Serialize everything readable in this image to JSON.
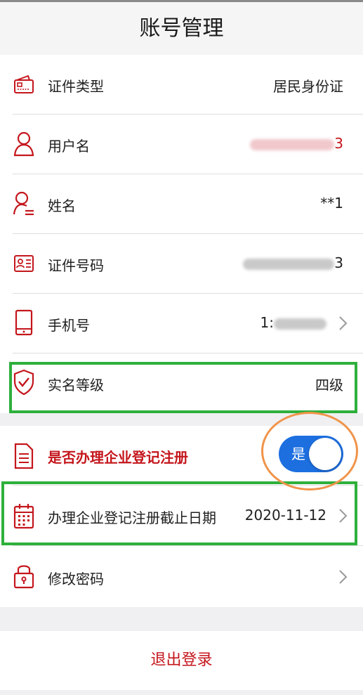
{
  "header": {
    "title": "账号管理"
  },
  "rows": {
    "id_type": {
      "label": "证件类型",
      "value": "居民身份证",
      "icon": "id-card-icon"
    },
    "username": {
      "label": "用户名",
      "value_tail": "3",
      "icon": "user-icon"
    },
    "name": {
      "label": "姓名",
      "value": "**1",
      "icon": "person-name-icon"
    },
    "id_number": {
      "label": "证件号码",
      "value_tail": "3",
      "icon": "id-badge-icon"
    },
    "phone": {
      "label": "手机号",
      "value_head": "1:",
      "icon": "mobile-phone-icon"
    },
    "realname_level": {
      "label": "实名等级",
      "value": "四级",
      "icon": "shield-check-icon"
    },
    "enterprise_registration": {
      "label": "是否办理企业登记注册",
      "toggle_label": "是",
      "toggle_on": true,
      "icon": "document-icon"
    },
    "registration_deadline": {
      "label": "办理企业登记注册截止日期",
      "value": "2020-11-12",
      "icon": "calendar-icon"
    },
    "change_password": {
      "label": "修改密码",
      "icon": "lock-icon"
    }
  },
  "logout": {
    "label": "退出登录"
  },
  "colors": {
    "accent_red": "#c4161c",
    "toggle_blue": "#1d6fe0",
    "highlight_green": "#2eb03c",
    "highlight_orange": "#f0944a"
  }
}
